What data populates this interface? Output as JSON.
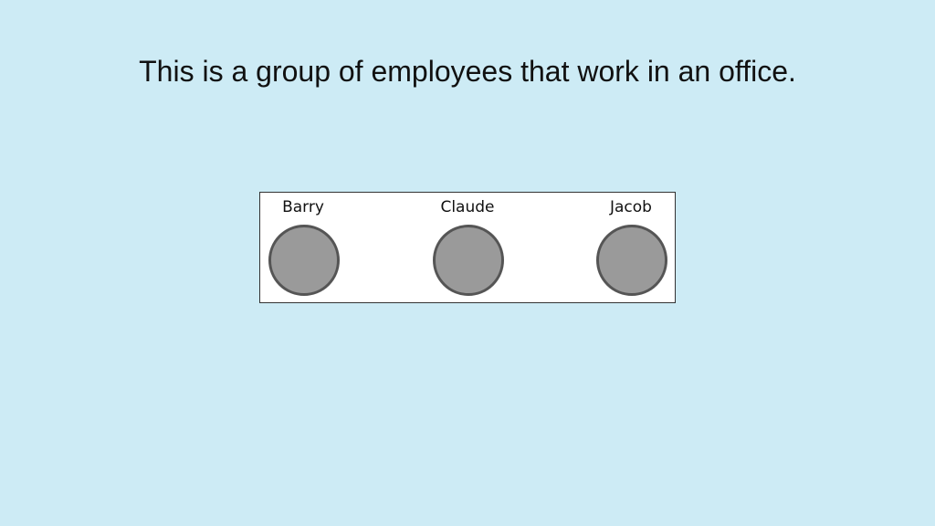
{
  "heading": "This is a group of employees that work in an office.",
  "employees": [
    {
      "name": "Barry"
    },
    {
      "name": "Claude"
    },
    {
      "name": "Jacob"
    }
  ],
  "colors": {
    "background": "#cdebf5",
    "box_fill": "#ffffff",
    "circle_fill": "#9a9a9a",
    "circle_stroke": "#555555"
  }
}
